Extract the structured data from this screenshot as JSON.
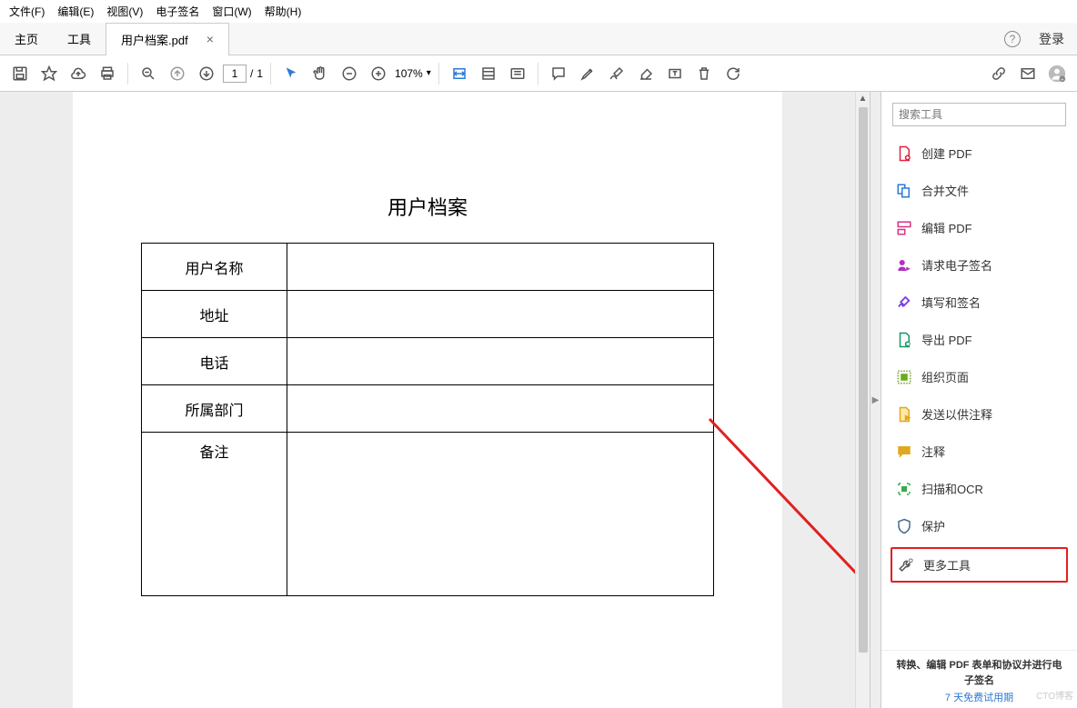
{
  "menubar": [
    "文件(F)",
    "编辑(E)",
    "视图(V)",
    "电子签名",
    "窗口(W)",
    "帮助(H)"
  ],
  "tabs": {
    "home": "主页",
    "tools": "工具",
    "doc": "用户档案.pdf",
    "help": "?",
    "login": "登录"
  },
  "toolbar": {
    "page_current": "1",
    "page_sep": "/",
    "page_total": "1",
    "zoom": "107%"
  },
  "document": {
    "title": "用户档案",
    "rows": [
      "用户名称",
      "地址",
      "电话",
      "所属部门",
      "备注"
    ]
  },
  "right_panel": {
    "search_placeholder": "搜索工具",
    "tools": [
      {
        "label": "创建 PDF",
        "color": "#e02040"
      },
      {
        "label": "合并文件",
        "color": "#2a7ad6"
      },
      {
        "label": "编辑 PDF",
        "color": "#d63384"
      },
      {
        "label": "请求电子签名",
        "color": "#b030c0"
      },
      {
        "label": "填写和签名",
        "color": "#7b3fe4"
      },
      {
        "label": "导出 PDF",
        "color": "#149966"
      },
      {
        "label": "组织页面",
        "color": "#6aaa20"
      },
      {
        "label": "发送以供注释",
        "color": "#e0a820"
      },
      {
        "label": "注释",
        "color": "#e0a820"
      },
      {
        "label": "扫描和OCR",
        "color": "#3aaa50"
      },
      {
        "label": "保护",
        "color": "#4a6a90"
      },
      {
        "label": "更多工具",
        "color": "#555"
      }
    ],
    "promo": "转换、编辑 PDF 表单和协议并进行电子签名",
    "trial": "7 天免费试用期",
    "watermark": "CTO博客"
  }
}
